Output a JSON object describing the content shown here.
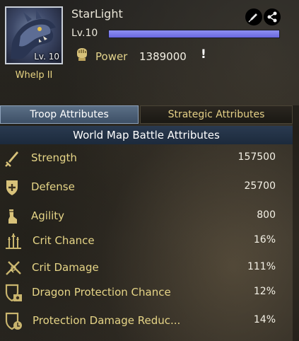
{
  "dragon": {
    "name": "StarLight",
    "level_label": "Lv.10",
    "level_progress": 1.0,
    "avatar_level": "Lv. 10",
    "avatar_name": "Whelp II",
    "power_label": "Power",
    "power_value": "1389000",
    "info_symbol": "!"
  },
  "icons": {
    "edit": "pen-icon",
    "share": "share-icon",
    "power": "fist-icon"
  },
  "tabs": [
    {
      "label": "Troop Attributes",
      "active": true
    },
    {
      "label": "Strategic Attributes",
      "active": false
    }
  ],
  "section_title": "World Map Battle Attributes",
  "attributes": [
    {
      "label": "Strength",
      "value": "157500",
      "icon": "sword-icon"
    },
    {
      "label": "Defense",
      "value": "25700",
      "icon": "shield-plus-icon"
    },
    {
      "label": "Agility",
      "value": "800",
      "icon": "boot-icon"
    },
    {
      "label": "Crit Chance",
      "value": "16%",
      "icon": "crit-chance-icon"
    },
    {
      "label": "Crit Damage",
      "value": "111%",
      "icon": "crit-damage-icon"
    },
    {
      "label": "Dragon Protection Chance",
      "value": "12%",
      "icon": "dragon-shield-icon"
    },
    {
      "label": "Protection Damage Reduc...",
      "value": "14%",
      "icon": "protection-shield-icon"
    }
  ],
  "colors": {
    "gold_text": "#e6d587",
    "level_bar": "#7b7ce9",
    "active_tab": "#4a5d75"
  }
}
